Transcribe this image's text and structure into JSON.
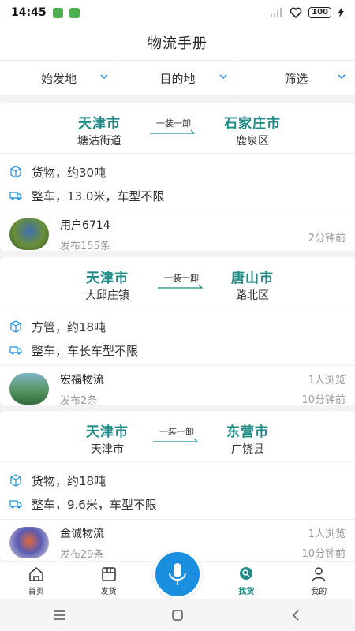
{
  "status": {
    "time": "14:45",
    "battery": "100"
  },
  "header": {
    "title": "物流手册"
  },
  "filters": [
    {
      "label": "始发地"
    },
    {
      "label": "目的地"
    },
    {
      "label": "筛选"
    }
  ],
  "cards": [
    {
      "from": {
        "city": "天津市",
        "area": "塘沽街道"
      },
      "to": {
        "city": "石家庄市",
        "area": "鹿泉区"
      },
      "route_tag": "一装一卸",
      "cargo": "货物，约30吨",
      "truck": "整车，13.0米，车型不限",
      "user": {
        "name": "用户6714",
        "posts": "发布155条",
        "views": "",
        "time": "2分钟前"
      }
    },
    {
      "from": {
        "city": "天津市",
        "area": "大邱庄镇"
      },
      "to": {
        "city": "唐山市",
        "area": "路北区"
      },
      "route_tag": "一装一卸",
      "cargo": "方管，约18吨",
      "truck": "整车，车长车型不限",
      "user": {
        "name": "宏福物流",
        "posts": "发布2条",
        "views": "1人浏览",
        "time": "10分钟前"
      }
    },
    {
      "from": {
        "city": "天津市",
        "area": "天津市"
      },
      "to": {
        "city": "东营市",
        "area": "广饶县"
      },
      "route_tag": "一装一卸",
      "cargo": "货物，约18吨",
      "truck": "整车，9.6米，车型不限",
      "user": {
        "name": "金诚物流",
        "posts": "发布29条",
        "views": "1人浏览",
        "time": "10分钟前"
      }
    }
  ],
  "tabs": [
    {
      "label": "首页",
      "icon": "home-icon"
    },
    {
      "label": "发货",
      "icon": "ship-goods-icon"
    },
    {
      "label": "找货",
      "icon": "find-goods-icon",
      "active": true
    },
    {
      "label": "我的",
      "icon": "profile-icon"
    }
  ],
  "colors": {
    "accent": "#1f8a86",
    "mic": "#1a8fe0"
  }
}
